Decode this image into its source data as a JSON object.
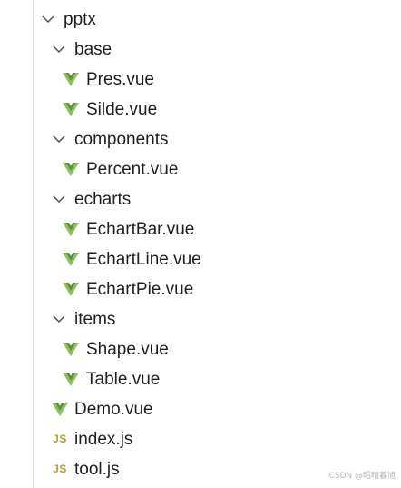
{
  "tree": {
    "root": "pptx",
    "folders": {
      "base": "base",
      "components": "components",
      "echarts": "echarts",
      "items": "items"
    },
    "files": {
      "pres": "Pres.vue",
      "silde": "Silde.vue",
      "percent": "Percent.vue",
      "echart_bar": "EchartBar.vue",
      "echart_line": "EchartLine.vue",
      "echart_pie": "EchartPie.vue",
      "shape": "Shape.vue",
      "table": "Table.vue",
      "demo": "Demo.vue",
      "index_js": "index.js",
      "tool_js": "tool.js"
    },
    "js_badge": "JS"
  },
  "colors": {
    "vue_green_light": "#8fbf63",
    "vue_green_dark": "#5e8f3a",
    "js_yellow": "#b3a12a",
    "chevron": "#4a4a4a"
  },
  "watermark": "CSDN @昭晴暮旭"
}
